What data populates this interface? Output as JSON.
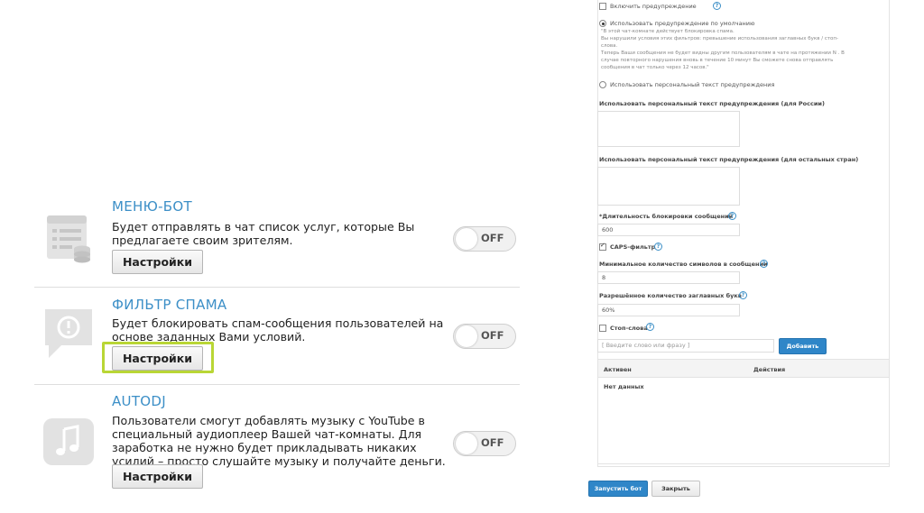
{
  "bots": [
    {
      "title": "МЕНЮ-БОТ",
      "description": "Будет отправлять в чат список услуг, которые Вы предлагаете своим зрителям.",
      "settings_label": "Настройки",
      "toggle_label": "OFF",
      "icon": "menu-list-icon"
    },
    {
      "title": "ФИЛЬТР СПАМА",
      "description": "Будет блокировать спам-сообщения пользователей на основе заданных Вами условий.",
      "settings_label": "Настройки",
      "toggle_label": "OFF",
      "icon": "spam-alert-bubble-icon"
    },
    {
      "title": "AUTODJ",
      "description": "Пользователи смогут добавлять музыку с YouTube в специальный аудиоплеер Вашей чат-комнаты. Для заработка не нужно будет прикладывать никаких усилий – просто слушайте музыку и получайте деньги.",
      "settings_label": "Настройки",
      "toggle_label": "OFF",
      "icon": "music-note-icon"
    }
  ],
  "spam_settings": {
    "enable_warning_label": "Включить предупреждение",
    "use_default_warning_label": "Использовать предупреждение по умолчанию",
    "default_warning_lines": [
      "\"В этой чат-комнате действует блокировка спама.",
      "Вы нарушили условия этих фильтров: превышение использования заглавных букв / стоп-",
      "слова.",
      "Теперь Ваши сообщения не будет видны другим пользователям в чате на протяжении N . В",
      "случае повторного нарушения вновь в течение 10 минут Вы сможете снова отправлять",
      "сообщения в чат только через 12 часов.\""
    ],
    "use_custom_warning_label": "Использовать персональный текст предупреждения",
    "custom_text_russia_label": "Использовать персональный текст предупреждения (для России)",
    "custom_text_other_label": "Использовать персональный текст предупреждения (для остальных стран)",
    "block_duration_label": "*Длительность блокировки сообщений",
    "block_duration_value": "600",
    "caps_filter_label": "CAPS-фильтр",
    "min_chars_label": "Минимальное количество символов в сообщении",
    "min_chars_value": "8",
    "allowed_caps_label": "Разрешённое количество заглавных букв",
    "allowed_caps_value": "60%",
    "stop_words_label": "Стоп-слова",
    "stop_words_placeholder": "[ Введите слово или фразу ]",
    "add_button_label": "Добавить",
    "table_col_active": "Активен",
    "table_col_actions": "Действия",
    "no_data_label": "Нет данных",
    "start_bot_label": "Запустить бот",
    "close_label": "Закрыть"
  },
  "colors": {
    "accent_blue": "#3c8fc7",
    "highlight_green": "#b9d635",
    "button_blue": "#2f86c8"
  }
}
